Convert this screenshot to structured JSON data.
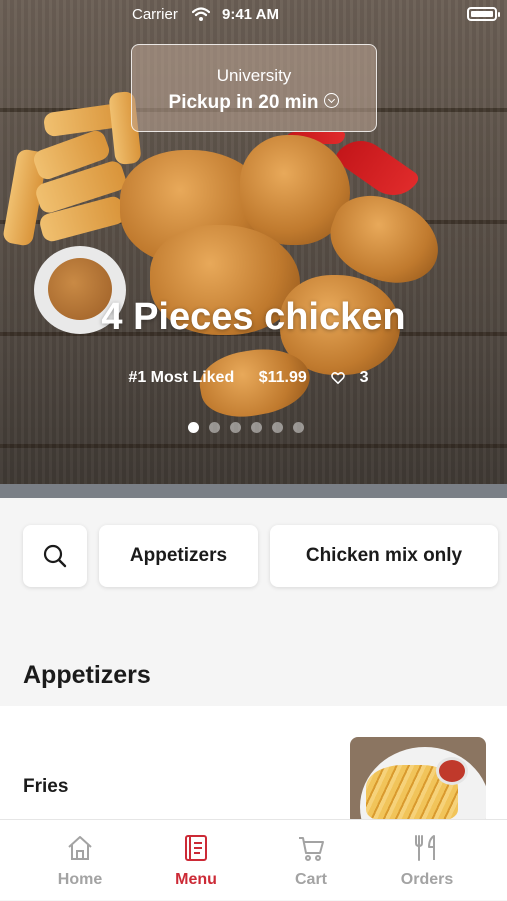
{
  "status_bar": {
    "carrier": "Carrier",
    "time": "9:41 AM"
  },
  "pickup": {
    "location": "University",
    "time_label": "Pickup in 20 min"
  },
  "hero": {
    "title": "4 Pieces chicken",
    "badge": "#1 Most Liked",
    "price": "$11.99",
    "likes": "3",
    "carousel": {
      "count": 6,
      "active_index": 0
    }
  },
  "categories": {
    "search_icon": "search-icon",
    "pills": [
      "Appetizers",
      "Chicken mix only"
    ]
  },
  "section": {
    "title": "Appetizers"
  },
  "menu_items": [
    {
      "name": "Fries"
    }
  ],
  "tabbar": {
    "items": [
      {
        "label": "Home",
        "icon": "home-icon"
      },
      {
        "label": "Menu",
        "icon": "menu-book-icon"
      },
      {
        "label": "Cart",
        "icon": "cart-icon"
      },
      {
        "label": "Orders",
        "icon": "fork-knife-icon"
      }
    ],
    "active": "Menu"
  },
  "colors": {
    "accent": "#cc2a36",
    "inactive": "#a3a3a3",
    "text": "#1b1b1b"
  }
}
